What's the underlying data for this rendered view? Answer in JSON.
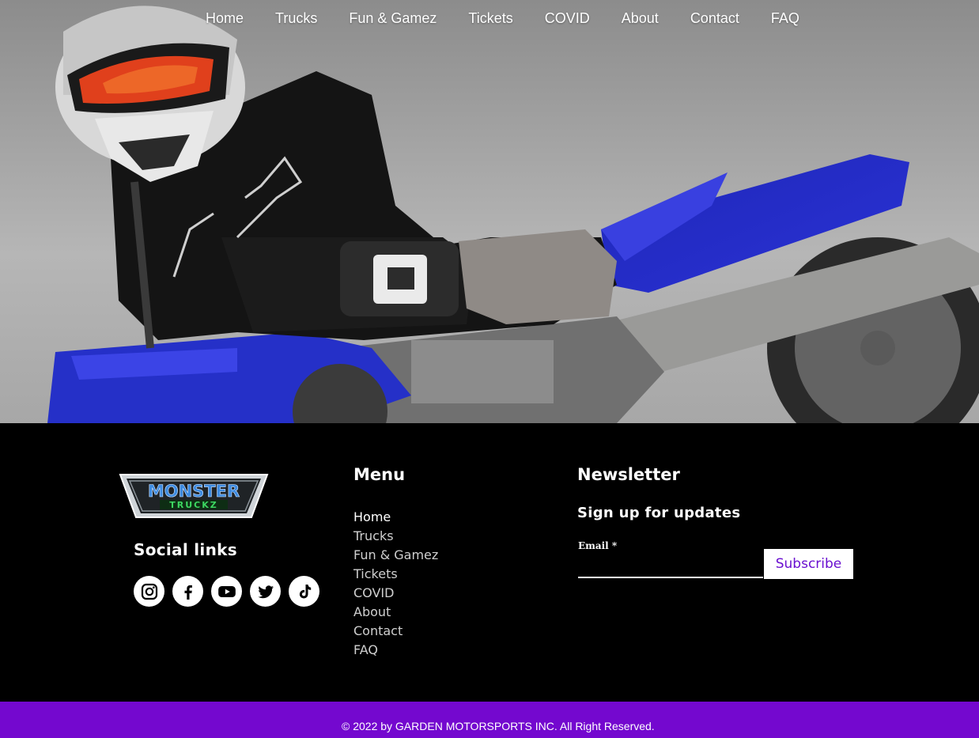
{
  "nav": {
    "items": [
      "Home",
      "Trucks",
      "Fun & Gamez",
      "Tickets",
      "COVID",
      "About",
      "Contact",
      "FAQ"
    ]
  },
  "hero": {
    "image_alt": "Dirt bike rider on a blue motorcycle"
  },
  "logo": {
    "line1": "MONSTER",
    "line2": "TRUCKZ"
  },
  "social": {
    "title": "Social links",
    "icons": [
      "instagram-icon",
      "facebook-icon",
      "youtube-icon",
      "twitter-icon",
      "tiktok-icon"
    ]
  },
  "footer_menu": {
    "title": "Menu",
    "items": [
      "Home",
      "Trucks",
      "Fun & Gamez",
      "Tickets",
      "COVID",
      "About",
      "Contact",
      "FAQ"
    ]
  },
  "newsletter": {
    "title": "Newsletter",
    "subtitle": "Sign up for updates",
    "email_label": "Email *",
    "email_value": "",
    "subscribe_label": "Subscribe"
  },
  "copyright": "© 2022 by GARDEN MOTORSPORTS INC. All Right Reserved.",
  "colors": {
    "accent": "#7408cf",
    "footer_bg": "#000000",
    "subscribe_text": "#6a0fd0"
  }
}
